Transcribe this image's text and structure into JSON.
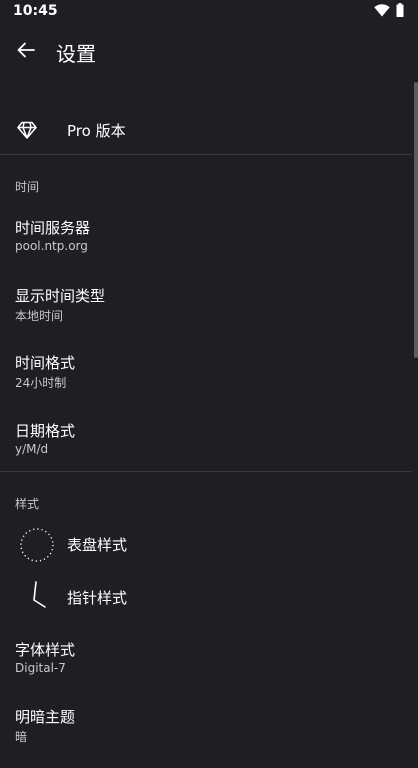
{
  "status_bar": {
    "time": "10:45",
    "icons": [
      "wifi-icon",
      "battery-icon"
    ]
  },
  "app_bar": {
    "title": "设置",
    "back_icon": "arrow-left-icon"
  },
  "pro": {
    "label": "Pro 版本",
    "icon": "diamond-icon"
  },
  "sections": {
    "time": {
      "header": "时间",
      "items": [
        {
          "title": "时间服务器",
          "summary": "pool.ntp.org"
        },
        {
          "title": "显示时间类型",
          "summary": "本地时间"
        },
        {
          "title": "时间格式",
          "summary": "24小时制"
        },
        {
          "title": "日期格式",
          "summary": "y/M/d"
        }
      ]
    },
    "style": {
      "header": "样式",
      "dial_style": {
        "label": "表盘样式",
        "icon": "clock-dial-icon"
      },
      "hand_style": {
        "label": "指针样式",
        "icon": "clock-hands-icon"
      },
      "items": [
        {
          "title": "字体样式",
          "summary": "Digital-7"
        },
        {
          "title": "明暗主题",
          "summary": "暗"
        }
      ]
    }
  },
  "colors": {
    "background": "#1f1e22",
    "text_primary": "#ffffff",
    "text_secondary": "#c8c7cb",
    "divider": "#3a393d"
  }
}
